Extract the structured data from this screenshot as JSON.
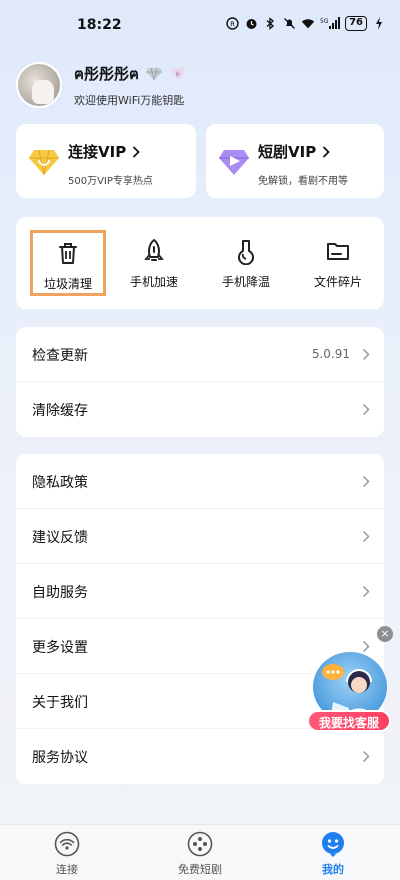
{
  "status_bar": {
    "time": "18:22",
    "battery": "76",
    "network": "5G"
  },
  "profile": {
    "username": "ฅ彤彤彤ฅ",
    "welcome": "欢迎使用WiFi万能钥匙"
  },
  "vip_cards": [
    {
      "title": "连接VIP",
      "subtitle": "500万VIP专享热点",
      "icon": "gold-diamond-icon",
      "color": "#f5c13b"
    },
    {
      "title": "短剧VIP",
      "subtitle": "免解锁，看剧不用等",
      "icon": "purple-diamond-icon",
      "color": "#8b62e6"
    }
  ],
  "tools": [
    {
      "label": "垃圾清理",
      "icon": "trash-icon"
    },
    {
      "label": "手机加速",
      "icon": "rocket-icon"
    },
    {
      "label": "手机降温",
      "icon": "thermometer-icon"
    },
    {
      "label": "文件碎片",
      "icon": "folder-icon"
    }
  ],
  "settings_group_1": [
    {
      "label": "检查更新",
      "value": "5.0.91"
    },
    {
      "label": "清除缓存",
      "value": ""
    }
  ],
  "settings_group_2": [
    {
      "label": "隐私政策"
    },
    {
      "label": "建议反馈"
    },
    {
      "label": "自助服务"
    },
    {
      "label": "更多设置"
    },
    {
      "label": "关于我们"
    },
    {
      "label": "服务协议"
    }
  ],
  "float_service": {
    "label": "我要找客服",
    "close": "×"
  },
  "bottom_nav": [
    {
      "label": "连接",
      "icon": "wifi-icon",
      "active": false
    },
    {
      "label": "免费短剧",
      "icon": "film-reel-icon",
      "active": false
    },
    {
      "label": "我的",
      "icon": "profile-icon",
      "active": true
    }
  ],
  "colors": {
    "accent": "#1f7ff0",
    "highlight_border": "#f0a35e",
    "service_red": "#ff4466"
  }
}
